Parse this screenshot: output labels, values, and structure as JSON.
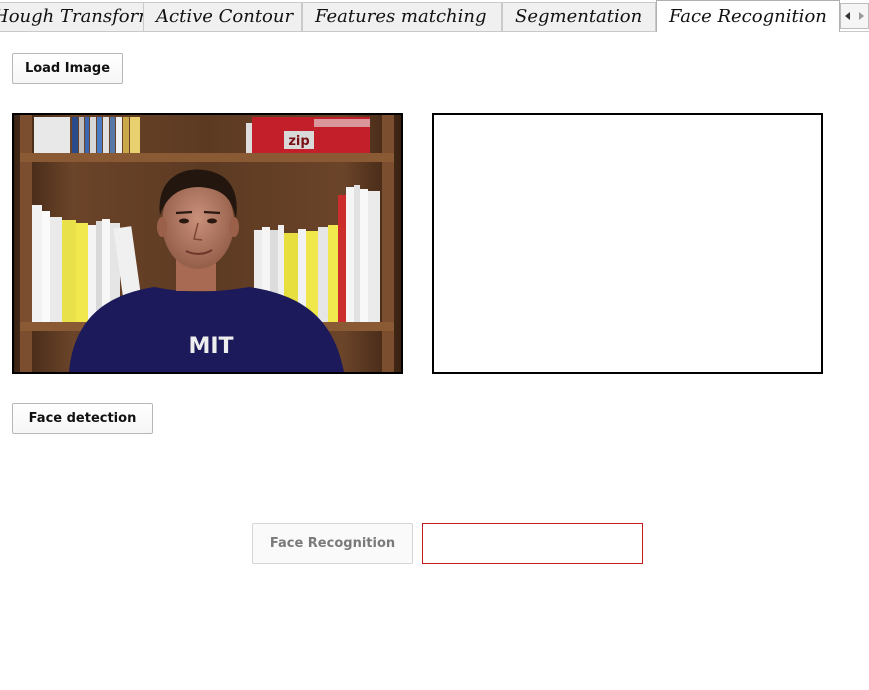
{
  "tabs": [
    {
      "label": "Hough Transform",
      "active": false
    },
    {
      "label": "Active Contour",
      "active": false
    },
    {
      "label": "Features matching",
      "active": false
    },
    {
      "label": "Segmentation",
      "active": false
    },
    {
      "label": "Face Recognition",
      "active": true
    }
  ],
  "buttons": {
    "load_image": "Load Image",
    "face_detection": "Face detection",
    "face_recognition": "Face Recognition"
  },
  "face_recognition_enabled": false,
  "result_field": {
    "value": "",
    "border_color": "#c41c1c"
  },
  "photo": {
    "subject": "man in navy t-shirt in front of bookshelf",
    "shirt_text": "MIT",
    "book_box_text": "zip"
  },
  "output_panel": {
    "empty": true
  },
  "icons": {
    "scroll_left": "chevron-left-icon",
    "scroll_right": "chevron-right-icon"
  }
}
